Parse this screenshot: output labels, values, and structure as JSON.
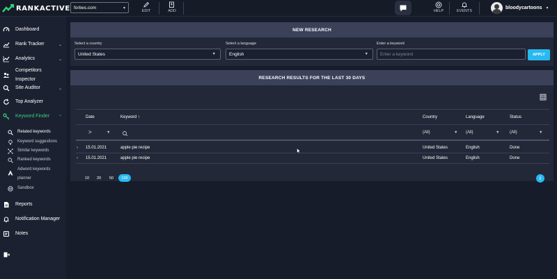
{
  "brand": {
    "name": "RANKACTIVE",
    "accent": "#34d27a",
    "button_color": "#28b9f1"
  },
  "topbar": {
    "domain_value": "forbes.com",
    "edit_label": "EDIT",
    "add_label": "ADD",
    "help_label": "HELP",
    "events_label": "EVENTS",
    "username": "bloodycartoons"
  },
  "sidebar": {
    "items": [
      {
        "label": "Dashboard",
        "icon": "gauge-icon"
      },
      {
        "label": "Rank Tracker",
        "icon": "trend-icon"
      },
      {
        "label": "Analytics",
        "icon": "chart-icon"
      },
      {
        "label": "Competitors Inspector",
        "icon": "competitors-icon"
      },
      {
        "label": "Site Auditor",
        "icon": "search-icon"
      },
      {
        "label": "Top Analyzer",
        "icon": "refresh-icon"
      },
      {
        "label": "Keyword Finder",
        "icon": "key-icon"
      },
      {
        "label": "Reports",
        "icon": "report-icon"
      },
      {
        "label": "Notification Manager",
        "icon": "bell-icon"
      },
      {
        "label": "Notes",
        "icon": "notes-icon"
      }
    ],
    "competitors_line1": "Competitors",
    "competitors_line2": "Inspector",
    "subitems": [
      {
        "label": "Related keywords",
        "icon": "magnifier-icon"
      },
      {
        "label": "Keyword suggestions",
        "icon": "bulb-icon"
      },
      {
        "label": "Similar keywords",
        "icon": "network-icon"
      },
      {
        "label": "Ranked keywords",
        "icon": "magnifier-icon"
      },
      {
        "label": "Adword keywords",
        "icon": "adwords-icon"
      },
      {
        "label": "Sandbox",
        "icon": "sandbox-icon"
      }
    ],
    "adword_line2": "planner"
  },
  "research": {
    "title": "NEW RESEARCH",
    "country_label": "Select a country",
    "country_value": "United States",
    "language_label": "Select a language",
    "language_value": "English",
    "keyword_label": "Enter a keyword",
    "keyword_placeholder": "Enter a keyword",
    "apply_label": "APPLY"
  },
  "results": {
    "title": "RESEARCH RESULTS FOR THE LAST 30 DAYS",
    "columns": {
      "date": "Date",
      "keyword": "Keyword",
      "country": "Country",
      "language": "Language",
      "status": "Status"
    },
    "filters": {
      "date_op": ">",
      "country": "(All)",
      "language": "(All)",
      "status": "(All)"
    },
    "rows": [
      {
        "date": "15.01.2021",
        "keyword": "apple pie recipe",
        "country": "United States",
        "language": "English",
        "status": "Done"
      },
      {
        "date": "15.01.2021",
        "keyword": "apple pie recipe",
        "country": "United States",
        "language": "English",
        "status": "Done"
      }
    ],
    "page_sizes": [
      "10",
      "20",
      "50",
      "100"
    ],
    "active_page_size": "100",
    "info_glyph": "i"
  }
}
